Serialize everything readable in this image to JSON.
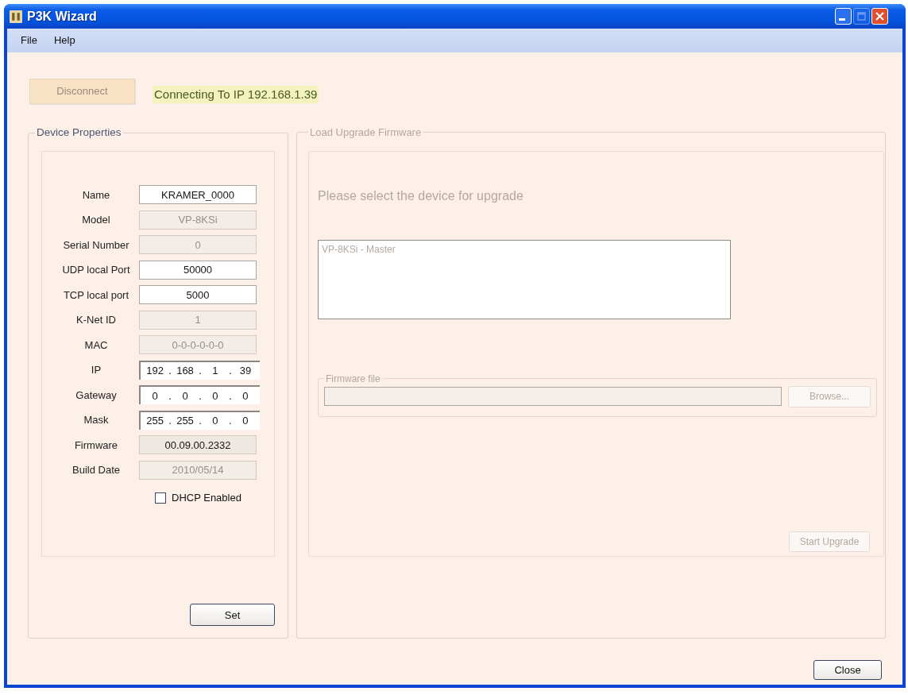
{
  "window": {
    "title": "P3K Wizard",
    "buttons": [
      {
        "kind": "minimize",
        "disabled": false
      },
      {
        "kind": "maximize",
        "disabled": true
      },
      {
        "kind": "close",
        "disabled": false
      }
    ]
  },
  "menu": [
    "File",
    "Help"
  ],
  "connection": {
    "button": "Disconnect",
    "status": "Connecting To IP 192.168.1.39"
  },
  "device_properties": {
    "title": "Device Properties",
    "fields": [
      {
        "kind": "text",
        "label": "Name",
        "value": "KRAMER_0000",
        "disabled": false,
        "readonly": false
      },
      {
        "kind": "text",
        "label": "Model",
        "value": "VP-8KSi",
        "disabled": true,
        "readonly": false
      },
      {
        "kind": "text",
        "label": "Serial Number",
        "value": "0",
        "disabled": true,
        "readonly": false
      },
      {
        "kind": "text",
        "label": "UDP local Port",
        "value": "50000",
        "disabled": false,
        "readonly": false
      },
      {
        "kind": "text",
        "label": "TCP local port",
        "value": "5000",
        "disabled": false,
        "readonly": false
      },
      {
        "kind": "text",
        "label": "K-Net ID",
        "value": "1",
        "disabled": true,
        "readonly": false
      },
      {
        "kind": "text",
        "label": "MAC",
        "value": "0-0-0-0-0-0",
        "disabled": true,
        "readonly": false
      },
      {
        "kind": "ip",
        "label": "IP",
        "octets": [
          "192",
          "168",
          "1",
          "39"
        ],
        "separators": [
          ".",
          ".",
          "."
        ],
        "disabled": false,
        "readonly": false
      },
      {
        "kind": "ip",
        "label": "Gateway",
        "octets": [
          "0",
          "0",
          "0",
          "0"
        ],
        "separators": [
          ".",
          ".",
          "."
        ],
        "disabled": false,
        "readonly": false
      },
      {
        "kind": "ip",
        "label": "Mask",
        "octets": [
          "255",
          "255",
          "0",
          "0"
        ],
        "separators": [
          ".",
          ".",
          "."
        ],
        "disabled": false,
        "readonly": false
      },
      {
        "kind": "text",
        "label": "Firmware",
        "value": "00.09.00.2332",
        "disabled": false,
        "readonly": true
      },
      {
        "kind": "text",
        "label": "Build Date",
        "value": "2010/05/14",
        "disabled": true,
        "readonly": false
      }
    ],
    "dhcp": {
      "label": "DHCP Enabled",
      "checked": false
    },
    "set_button": "Set"
  },
  "upgrade": {
    "title": "Load Upgrade Firmware",
    "disabled": true,
    "prompt": "Please select the device for upgrade",
    "devices": [
      {
        "name": "VP-8KSi - Master",
        "selected": false
      }
    ],
    "firmware_file": {
      "title": "Firmware file",
      "browse_button": "Browse..."
    },
    "start_button": "Start Upgrade"
  },
  "close_button": "Close"
}
